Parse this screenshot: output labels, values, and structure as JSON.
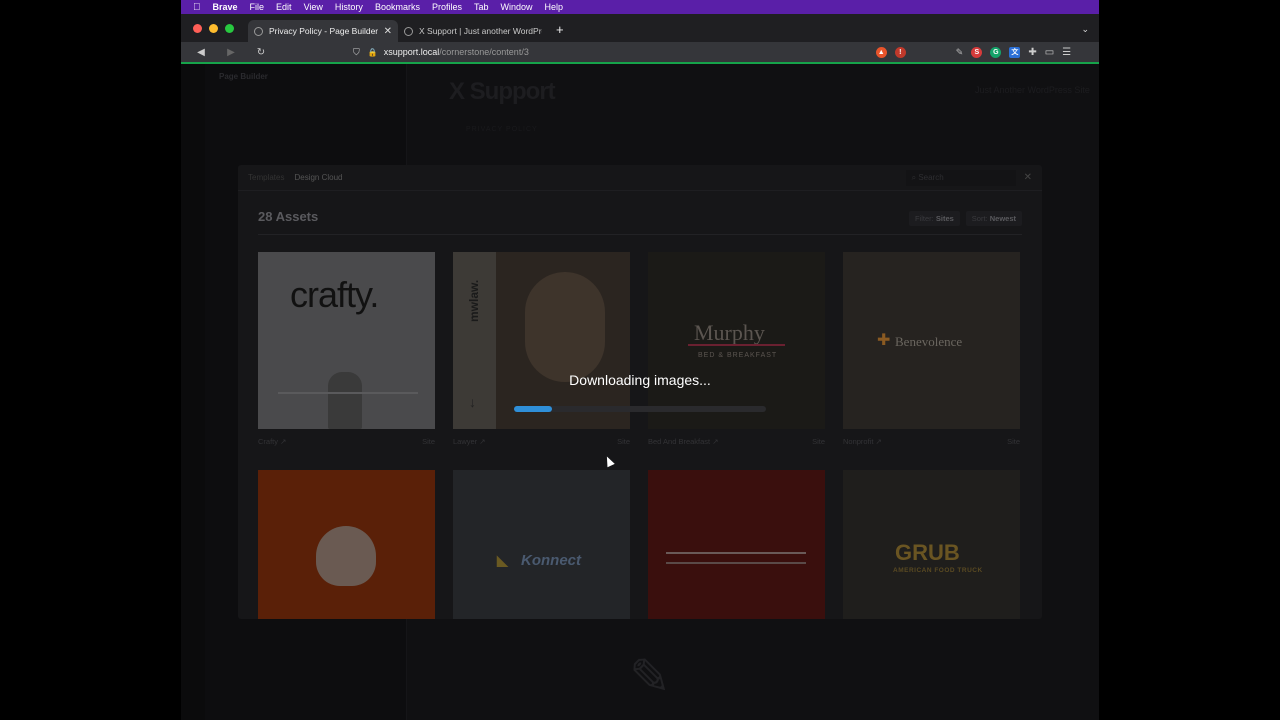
{
  "menubar": {
    "app": "Brave",
    "items": [
      "File",
      "Edit",
      "View",
      "History",
      "Bookmarks",
      "Profiles",
      "Tab",
      "Window",
      "Help"
    ]
  },
  "tabs": [
    {
      "label": "Privacy Policy - Page Builder - ",
      "active": true
    },
    {
      "label": "X Support | Just another WordPress",
      "active": false
    }
  ],
  "address": {
    "host": "xsupport.local",
    "path": "/cornerstone/content/3"
  },
  "app": {
    "sidebar_title": "Page Builder",
    "site_title": "X Support",
    "site_link": "Just Another WordPress Site",
    "breadcrumb": "PRIVACY POLICY"
  },
  "modal": {
    "tabs": [
      "Templates",
      "Design Cloud"
    ],
    "search_placeholder": "Search",
    "asset_count": "28 Assets",
    "filter_label": "Filter:",
    "filter_value": "Sites",
    "sort_label": "Sort:",
    "sort_value": "Newest"
  },
  "cards": [
    {
      "title": "crafty.",
      "name": "Crafty ↗",
      "kind": "Site"
    },
    {
      "title": "mwlaw.",
      "name": "Lawyer ↗",
      "kind": "Site"
    },
    {
      "title": "Murphy",
      "subtitle": "BED & BREAKFAST",
      "name": "Bed And Breakfast ↗",
      "kind": "Site"
    },
    {
      "title": "Benevolence",
      "name": "Nonprofit ↗",
      "kind": "Site"
    },
    {
      "title": "",
      "name": "",
      "kind": ""
    },
    {
      "title": "Konnect",
      "name": "",
      "kind": ""
    },
    {
      "title": "",
      "name": "",
      "kind": ""
    },
    {
      "title": "GRUB",
      "subtitle": "AMERICAN FOOD TRUCK",
      "name": "",
      "kind": ""
    }
  ],
  "download": {
    "message": "Downloading images...",
    "progress": 0.15
  },
  "colors": {
    "accent": "#2f8fd8",
    "menubar": "#5a1fa8"
  }
}
